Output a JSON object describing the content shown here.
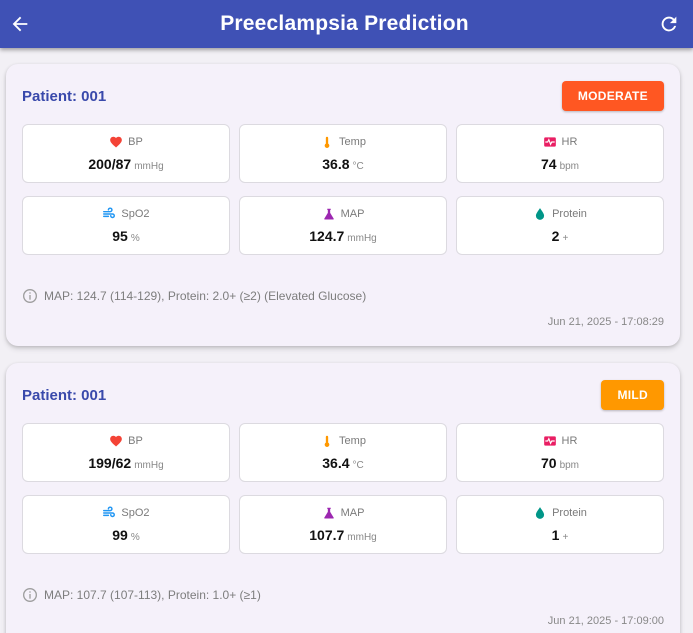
{
  "appbar": {
    "title": "Preeclampsia Prediction",
    "back_icon": "arrow-left-icon",
    "refresh_icon": "refresh-icon",
    "color": "#3f51b5"
  },
  "cards": [
    {
      "patient": "Patient: 001",
      "risk": "MODERATE",
      "risk_color": "#ff5722",
      "vitals": [
        {
          "label": "BP",
          "value": "200/87",
          "unit": "mmHg",
          "icon": "heart-icon"
        },
        {
          "label": "Temp",
          "value": "36.8",
          "unit": "°C",
          "icon": "thermometer-icon"
        },
        {
          "label": "HR",
          "value": "74",
          "unit": "bpm",
          "icon": "heart-monitor-icon"
        },
        {
          "label": "SpO2",
          "value": "95",
          "unit": "%",
          "icon": "air-icon"
        },
        {
          "label": "MAP",
          "value": "124.7",
          "unit": "mmHg",
          "icon": "flask-icon"
        },
        {
          "label": "Protein",
          "value": "2",
          "unit": "+",
          "icon": "water-drop-icon"
        }
      ],
      "note": "MAP: 124.7 (114-129), Protein: 2.0+ (≥2) (Elevated Glucose)",
      "timestamp": "Jun 21, 2025 - 17:08:29"
    },
    {
      "patient": "Patient: 001",
      "risk": "MILD",
      "risk_color": "#ff9800",
      "vitals": [
        {
          "label": "BP",
          "value": "199/62",
          "unit": "mmHg",
          "icon": "heart-icon"
        },
        {
          "label": "Temp",
          "value": "36.4",
          "unit": "°C",
          "icon": "thermometer-icon"
        },
        {
          "label": "HR",
          "value": "70",
          "unit": "bpm",
          "icon": "heart-monitor-icon"
        },
        {
          "label": "SpO2",
          "value": "99",
          "unit": "%",
          "icon": "air-icon"
        },
        {
          "label": "MAP",
          "value": "107.7",
          "unit": "mmHg",
          "icon": "flask-icon"
        },
        {
          "label": "Protein",
          "value": "1",
          "unit": "+",
          "icon": "water-drop-icon"
        }
      ],
      "note": "MAP: 107.7 (107-113), Protein: 1.0+ (≥1)",
      "timestamp": "Jun 21, 2025 - 17:09:00"
    }
  ]
}
